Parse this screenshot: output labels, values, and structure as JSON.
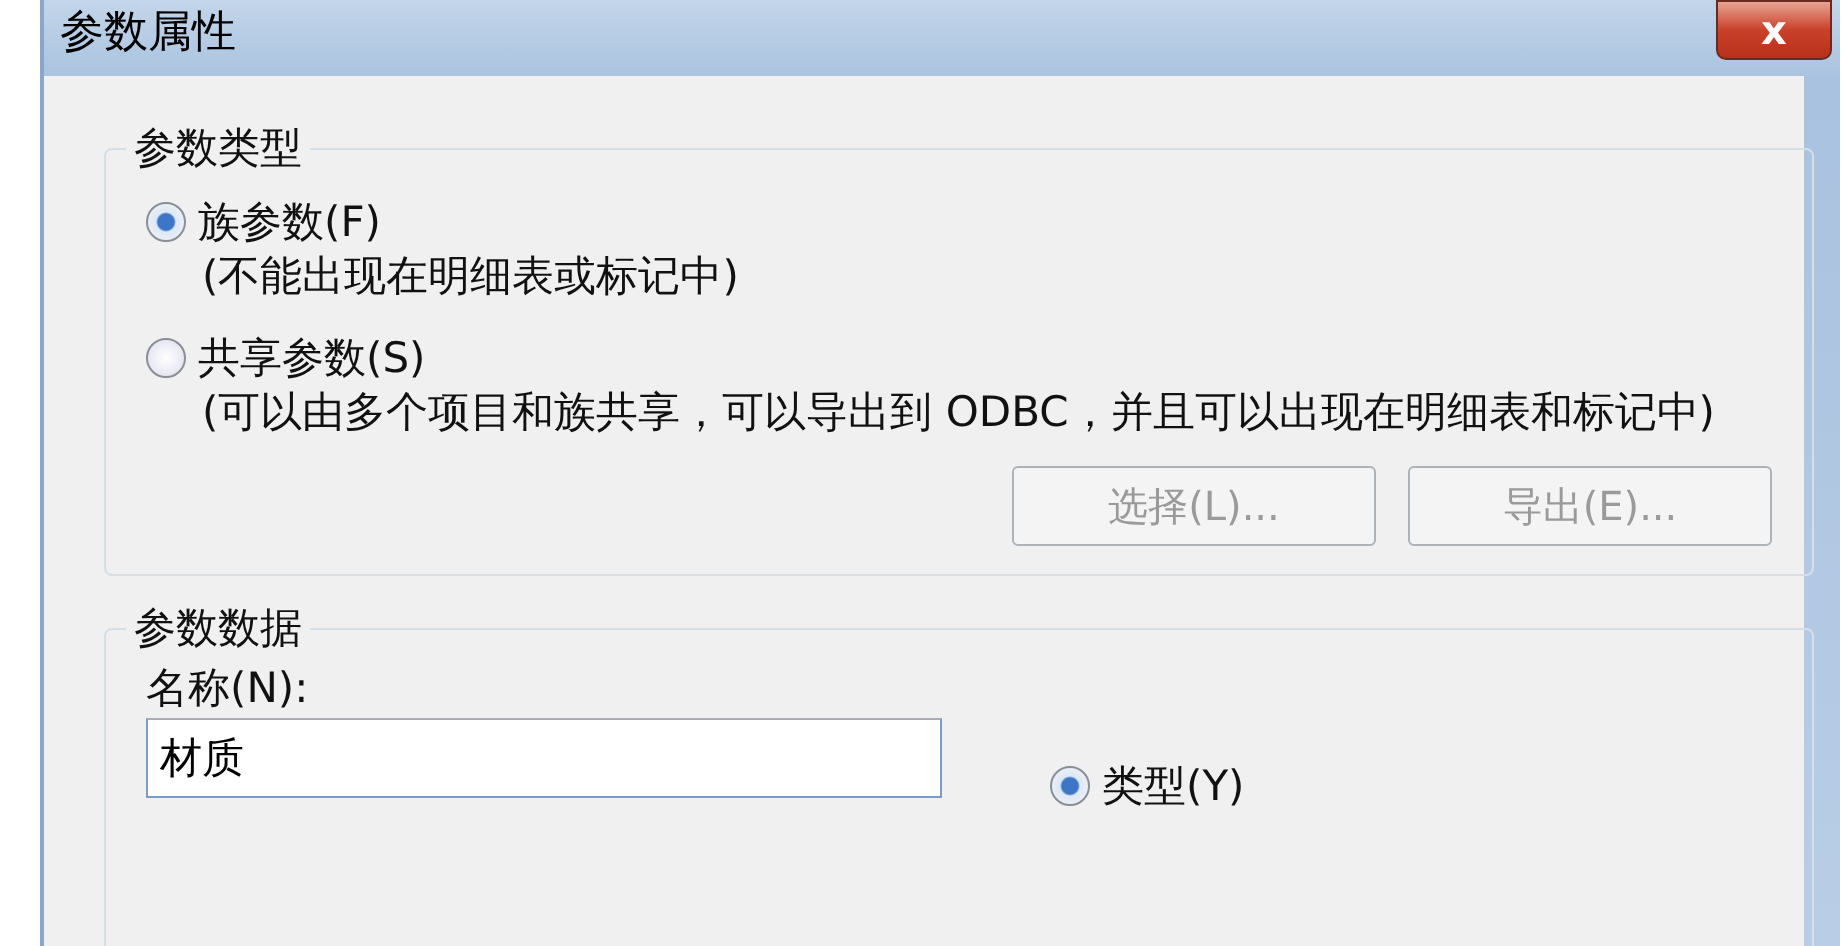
{
  "window": {
    "title": "参数属性",
    "close_label": "x"
  },
  "type_group": {
    "legend": "参数类型",
    "options": [
      {
        "label": "族参数(F)",
        "selected": true,
        "description": "(不能出现在明细表或标记中)"
      },
      {
        "label": "共享参数(S)",
        "selected": false,
        "description": "(可以由多个项目和族共享，可以导出到 ODBC，并且可以出现在明细表和标记中)"
      }
    ],
    "buttons": [
      {
        "label": "选择(L)...",
        "disabled": true
      },
      {
        "label": "导出(E)...",
        "disabled": true
      }
    ]
  },
  "data_group": {
    "legend": "参数数据",
    "name_label": "名称(N):",
    "name_value": "材质",
    "scope_options": [
      {
        "label": "类型(Y)",
        "selected": true
      }
    ]
  }
}
